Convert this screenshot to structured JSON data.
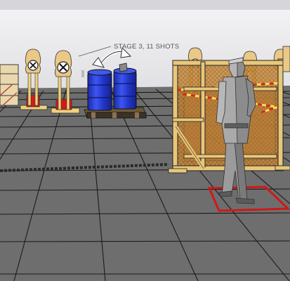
{
  "scene": {
    "stage_label": "STAGE 3, 11 SHOTS",
    "objects": {
      "targets": "cardboard IPSC targets on stands",
      "barrels": "two blue steel drums on a wooden pallet",
      "shooter": "grey low-poly shooter figure",
      "shooting_box": "red shooting box outline on floor",
      "barricade": "wooden frame barricade with orange mesh and yellow/red caution tape"
    },
    "colors": {
      "floor": "#6e6e6e",
      "grid": "#1a1a1a",
      "wall": "#e6e6ea",
      "wood": "#e8c77a",
      "barrel": "#2a3fd6",
      "box": "#d01818",
      "mesh": "#c98634"
    }
  }
}
